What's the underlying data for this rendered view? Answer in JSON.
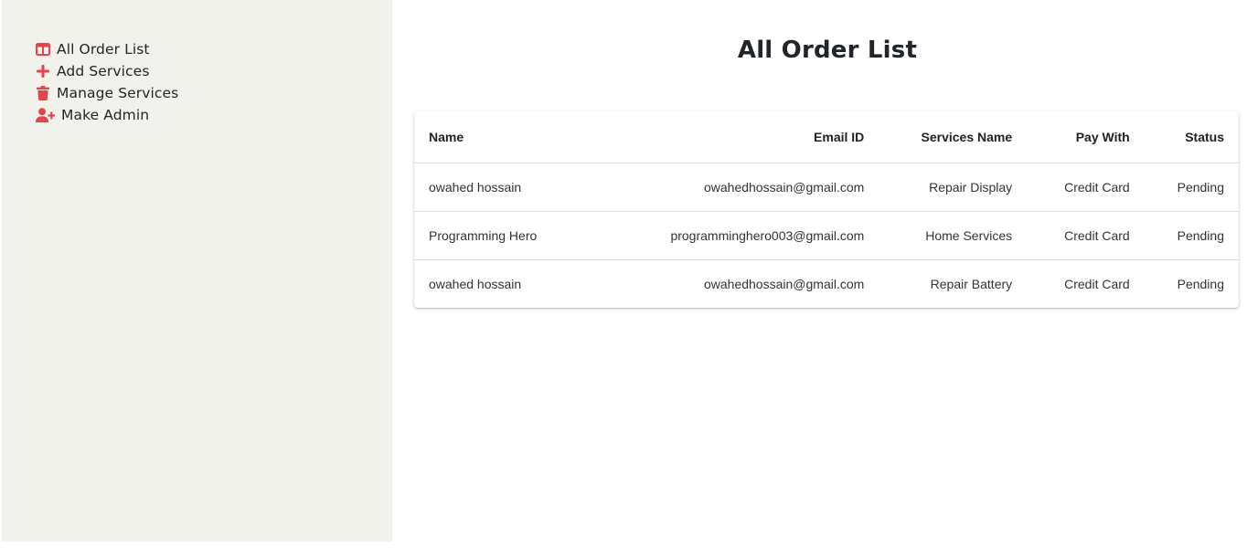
{
  "sidebar": {
    "items": [
      {
        "label": "All Order List",
        "icon": "table-columns-icon"
      },
      {
        "label": "Add Services",
        "icon": "plus-icon"
      },
      {
        "label": "Manage Services",
        "icon": "trash-icon"
      },
      {
        "label": "Make Admin",
        "icon": "user-plus-icon"
      }
    ]
  },
  "main": {
    "title": "All Order List",
    "table": {
      "headers": {
        "name": "Name",
        "email": "Email ID",
        "service": "Services Name",
        "pay": "Pay With",
        "status": "Status"
      },
      "rows": [
        {
          "name": "owahed hossain",
          "email": "owahedhossain@gmail.com",
          "service": "Repair Display",
          "pay": "Credit Card",
          "status": "Pending"
        },
        {
          "name": "Programming Hero",
          "email": "programminghero003@gmail.com",
          "service": "Home Services",
          "pay": "Credit Card",
          "status": "Pending"
        },
        {
          "name": "owahed hossain",
          "email": "owahedhossain@gmail.com",
          "service": "Repair Battery",
          "pay": "Credit Card",
          "status": "Pending"
        }
      ]
    }
  },
  "colors": {
    "accent": "#e8434a",
    "sidebar_bg": "#f2f2ed",
    "text": "#212529"
  }
}
